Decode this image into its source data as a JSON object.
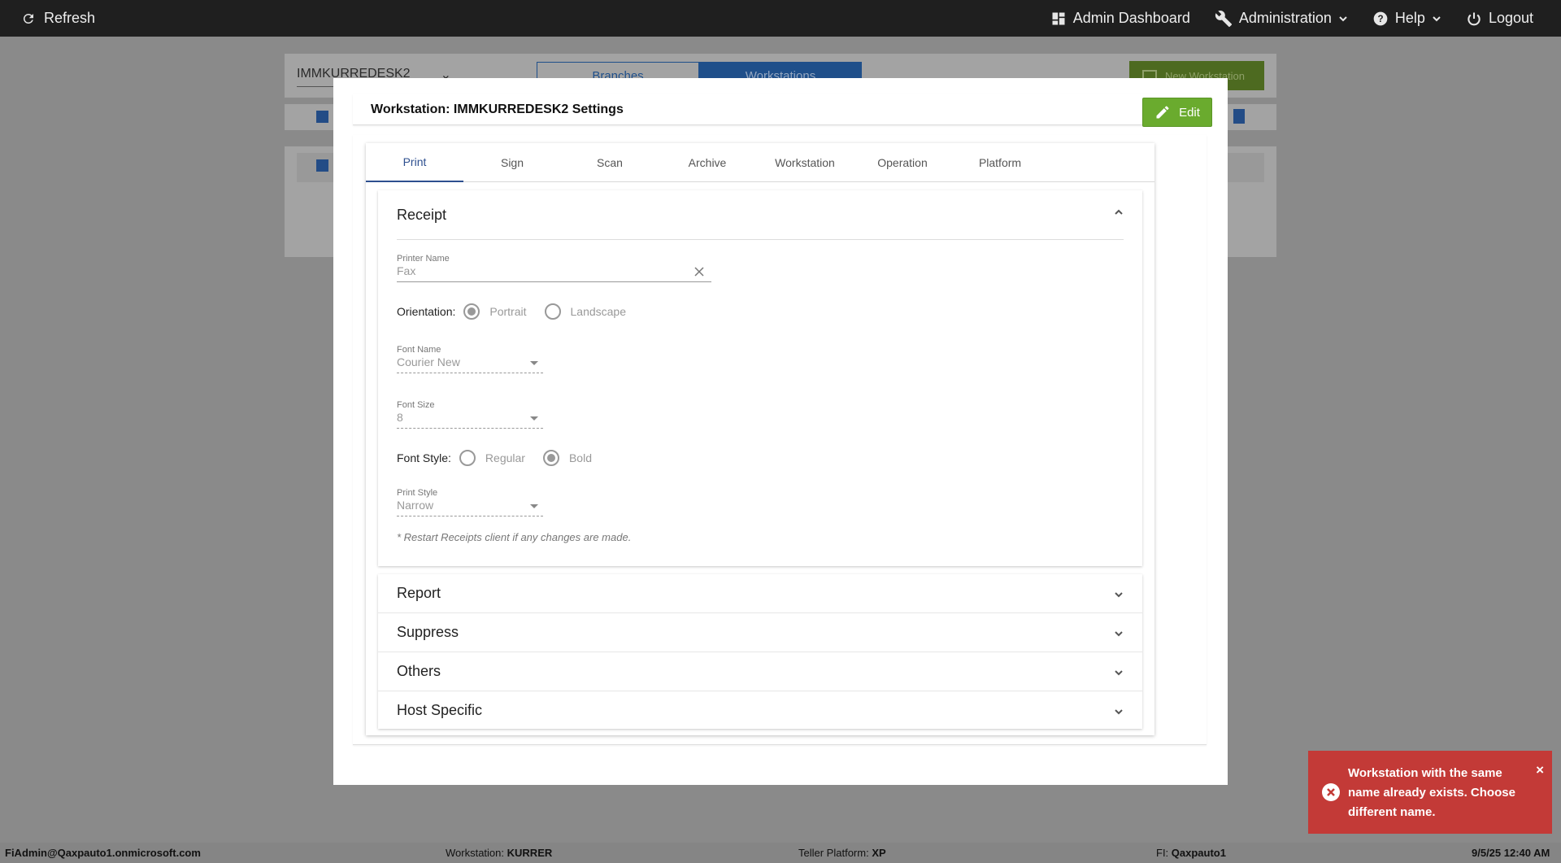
{
  "topbar": {
    "refresh_label": "Refresh",
    "nav": {
      "admin_dashboard": "Admin Dashboard",
      "administration": "Administration",
      "help": "Help",
      "logout": "Logout"
    }
  },
  "background": {
    "branch_select": "IMMKURREDESK2",
    "tabs": [
      "Branches",
      "Workstations"
    ],
    "active_tab": "Workstations",
    "new_button": "New Workstation"
  },
  "modal": {
    "title": "Workstation: IMMKURREDESK2 Settings",
    "edit_label": "Edit",
    "tabs": [
      "Print",
      "Sign",
      "Scan",
      "Archive",
      "Workstation",
      "Operation",
      "Platform"
    ],
    "active_tab": "Print",
    "receipt": {
      "title": "Receipt",
      "printer_name_label": "Printer Name",
      "printer_name_value": "Fax",
      "orientation_label": "Orientation:",
      "orientation_options": [
        "Portrait",
        "Landscape"
      ],
      "orientation_selected": "Portrait",
      "font_name_label": "Font Name",
      "font_name_value": "Courier New",
      "font_size_label": "Font Size",
      "font_size_value": "8",
      "font_style_label": "Font Style:",
      "font_style_options": [
        "Regular",
        "Bold"
      ],
      "font_style_selected": "Bold",
      "print_style_label": "Print Style",
      "print_style_value": "Narrow",
      "note": "* Restart Receipts client if any changes are made."
    },
    "sections": [
      "Report",
      "Suppress",
      "Others",
      "Host Specific"
    ]
  },
  "toast": {
    "message": "Workstation with the same name already exists. Choose different name.",
    "color": "#c33a37"
  },
  "statusbar": {
    "user": "FiAdmin@Qaxpauto1.onmicrosoft.com",
    "workstation_label": "Workstation:",
    "workstation_value": "KURRER",
    "platform_label": "Teller Platform:",
    "platform_value": "XP",
    "fi_label": "FI:",
    "fi_value": "Qaxpauto1",
    "datetime": "9/5/25 12:40 AM"
  },
  "colors": {
    "accent": "#2d4f8f",
    "edit_button": "#6aab2e",
    "topbar": "#1f1f1f"
  }
}
